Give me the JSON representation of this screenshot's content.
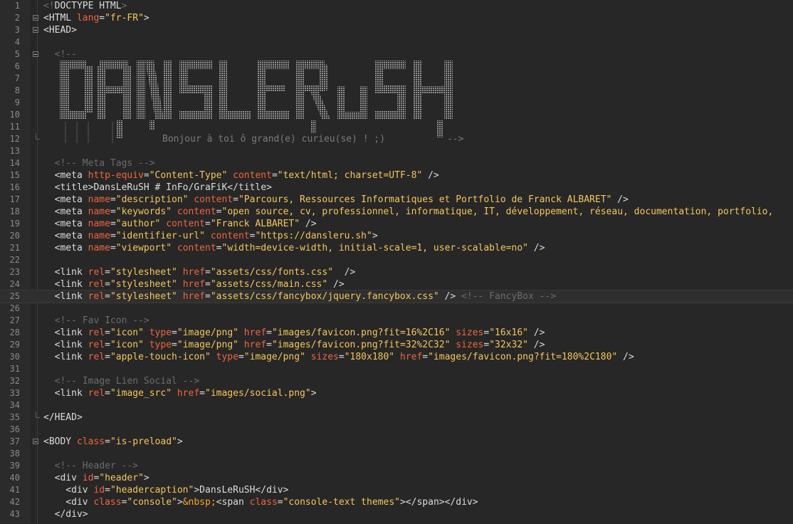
{
  "editor": {
    "lines": [
      {
        "n": "1",
        "fold": "",
        "active": false,
        "toks": [
          [
            "c",
            "<!"
          ],
          [
            "t",
            "DOCTYPE HTML"
          ],
          [
            "c",
            ">"
          ]
        ]
      },
      {
        "n": "2",
        "fold": "box",
        "active": false,
        "toks": [
          [
            "t",
            "<HTML "
          ],
          [
            "a",
            "lang"
          ],
          [
            "t",
            "="
          ],
          [
            "v",
            "\"fr-FR\""
          ],
          [
            "t",
            ">"
          ]
        ]
      },
      {
        "n": "3",
        "fold": "box",
        "active": false,
        "toks": [
          [
            "t",
            "<HEAD>"
          ]
        ]
      },
      {
        "n": "4",
        "fold": "",
        "active": false,
        "toks": []
      },
      {
        "n": "5",
        "fold": "box",
        "active": false,
        "toks": [
          [
            "t",
            "  "
          ],
          [
            "c",
            "<!--"
          ]
        ]
      },
      {
        "n": "6",
        "fold": "",
        "active": false,
        "toks": []
      },
      {
        "n": "7",
        "fold": "",
        "active": false,
        "toks": []
      },
      {
        "n": "8",
        "fold": "",
        "active": false,
        "toks": []
      },
      {
        "n": "9",
        "fold": "",
        "active": false,
        "toks": []
      },
      {
        "n": "10",
        "fold": "",
        "active": false,
        "toks": []
      },
      {
        "n": "11",
        "fold": "",
        "active": false,
        "toks": []
      },
      {
        "n": "12",
        "fold": "end",
        "active": false,
        "toks": []
      },
      {
        "n": "13",
        "fold": "",
        "active": false,
        "toks": []
      },
      {
        "n": "14",
        "fold": "",
        "active": false,
        "toks": [
          [
            "t",
            "  "
          ],
          [
            "c",
            "<!-- Meta Tags -->"
          ]
        ]
      },
      {
        "n": "15",
        "fold": "",
        "active": false,
        "toks": [
          [
            "t",
            "  <meta "
          ],
          [
            "a",
            "http-equiv"
          ],
          [
            "t",
            "="
          ],
          [
            "v",
            "\"Content-Type\""
          ],
          [
            "t",
            " "
          ],
          [
            "a",
            "content"
          ],
          [
            "t",
            "="
          ],
          [
            "v",
            "\"text/html; charset=UTF-8\""
          ],
          [
            "t",
            " />"
          ]
        ]
      },
      {
        "n": "16",
        "fold": "",
        "active": false,
        "toks": [
          [
            "t",
            "  <title>DansLeRuSH # InFo/GraFiK</title>"
          ]
        ]
      },
      {
        "n": "17",
        "fold": "",
        "active": false,
        "toks": [
          [
            "t",
            "  <meta "
          ],
          [
            "a",
            "name"
          ],
          [
            "t",
            "="
          ],
          [
            "v",
            "\"description\""
          ],
          [
            "t",
            " "
          ],
          [
            "a",
            "content"
          ],
          [
            "t",
            "="
          ],
          [
            "v",
            "\"Parcours, Ressources Informatiques et Portfolio de Franck ALBARET\""
          ],
          [
            "t",
            " />"
          ]
        ]
      },
      {
        "n": "18",
        "fold": "",
        "active": false,
        "toks": [
          [
            "t",
            "  <meta "
          ],
          [
            "a",
            "name"
          ],
          [
            "t",
            "="
          ],
          [
            "v",
            "\"keywords\""
          ],
          [
            "t",
            " "
          ],
          [
            "a",
            "content"
          ],
          [
            "t",
            "="
          ],
          [
            "v",
            "\"open source, cv, professionnel, informatique, IT, développement, réseau, documentation, portfolio,"
          ]
        ]
      },
      {
        "n": "19",
        "fold": "",
        "active": false,
        "toks": [
          [
            "t",
            "  <meta "
          ],
          [
            "a",
            "name"
          ],
          [
            "t",
            "="
          ],
          [
            "v",
            "\"author\""
          ],
          [
            "t",
            " "
          ],
          [
            "a",
            "content"
          ],
          [
            "t",
            "="
          ],
          [
            "v",
            "\"Franck ALBARET\""
          ],
          [
            "t",
            " />"
          ]
        ]
      },
      {
        "n": "20",
        "fold": "",
        "active": false,
        "toks": [
          [
            "t",
            "  <meta "
          ],
          [
            "a",
            "name"
          ],
          [
            "t",
            "="
          ],
          [
            "v",
            "\"identifier-url\""
          ],
          [
            "t",
            " "
          ],
          [
            "a",
            "content"
          ],
          [
            "t",
            "="
          ],
          [
            "v",
            "\"https://dansleru.sh\""
          ],
          [
            "t",
            ">"
          ]
        ]
      },
      {
        "n": "21",
        "fold": "",
        "active": false,
        "toks": [
          [
            "t",
            "  <meta "
          ],
          [
            "a",
            "name"
          ],
          [
            "t",
            "="
          ],
          [
            "v",
            "\"viewport\""
          ],
          [
            "t",
            " "
          ],
          [
            "a",
            "content"
          ],
          [
            "t",
            "="
          ],
          [
            "v",
            "\"width=device-width, initial-scale=1, user-scalable=no\""
          ],
          [
            "t",
            " />"
          ]
        ]
      },
      {
        "n": "22",
        "fold": "",
        "active": false,
        "toks": []
      },
      {
        "n": "23",
        "fold": "",
        "active": false,
        "toks": [
          [
            "t",
            "  <link "
          ],
          [
            "a",
            "rel"
          ],
          [
            "t",
            "="
          ],
          [
            "v",
            "\"stylesheet\""
          ],
          [
            "t",
            " "
          ],
          [
            "a",
            "href"
          ],
          [
            "t",
            "="
          ],
          [
            "v",
            "\"assets/css/fonts.css\""
          ],
          [
            "t",
            "  />"
          ]
        ]
      },
      {
        "n": "24",
        "fold": "",
        "active": false,
        "toks": [
          [
            "t",
            "  <link "
          ],
          [
            "a",
            "rel"
          ],
          [
            "t",
            "="
          ],
          [
            "v",
            "\"stylesheet\""
          ],
          [
            "t",
            " "
          ],
          [
            "a",
            "href"
          ],
          [
            "t",
            "="
          ],
          [
            "v",
            "\"assets/css/main.css\""
          ],
          [
            "t",
            " />"
          ]
        ]
      },
      {
        "n": "25",
        "fold": "",
        "active": true,
        "toks": [
          [
            "t",
            "  <link "
          ],
          [
            "a",
            "rel"
          ],
          [
            "t",
            "="
          ],
          [
            "v",
            "\"stylesheet\""
          ],
          [
            "t",
            " "
          ],
          [
            "a",
            "href"
          ],
          [
            "t",
            "="
          ],
          [
            "v",
            "\"assets/css/fancybox/jquery.fancybox.css\""
          ],
          [
            "t",
            " /> "
          ],
          [
            "c",
            "<!-- FancyBox -->"
          ]
        ]
      },
      {
        "n": "26",
        "fold": "",
        "active": false,
        "toks": []
      },
      {
        "n": "27",
        "fold": "",
        "active": false,
        "toks": [
          [
            "t",
            "  "
          ],
          [
            "c",
            "<!-- Fav Icon -->"
          ]
        ]
      },
      {
        "n": "28",
        "fold": "",
        "active": false,
        "toks": [
          [
            "t",
            "  <link "
          ],
          [
            "a",
            "rel"
          ],
          [
            "t",
            "="
          ],
          [
            "v",
            "\"icon\""
          ],
          [
            "t",
            " "
          ],
          [
            "a",
            "type"
          ],
          [
            "t",
            "="
          ],
          [
            "v",
            "\"image/png\""
          ],
          [
            "t",
            " "
          ],
          [
            "a",
            "href"
          ],
          [
            "t",
            "="
          ],
          [
            "v",
            "\"images/favicon.png?fit=16%2C16\""
          ],
          [
            "t",
            " "
          ],
          [
            "a",
            "sizes"
          ],
          [
            "t",
            "="
          ],
          [
            "v",
            "\"16x16\""
          ],
          [
            "t",
            " />"
          ]
        ]
      },
      {
        "n": "29",
        "fold": "",
        "active": false,
        "toks": [
          [
            "t",
            "  <link "
          ],
          [
            "a",
            "rel"
          ],
          [
            "t",
            "="
          ],
          [
            "v",
            "\"icon\""
          ],
          [
            "t",
            " "
          ],
          [
            "a",
            "type"
          ],
          [
            "t",
            "="
          ],
          [
            "v",
            "\"image/png\""
          ],
          [
            "t",
            " "
          ],
          [
            "a",
            "href"
          ],
          [
            "t",
            "="
          ],
          [
            "v",
            "\"images/favicon.png?fit=32%2C32\""
          ],
          [
            "t",
            " "
          ],
          [
            "a",
            "sizes"
          ],
          [
            "t",
            "="
          ],
          [
            "v",
            "\"32x32\""
          ],
          [
            "t",
            " />"
          ]
        ]
      },
      {
        "n": "30",
        "fold": "",
        "active": false,
        "toks": [
          [
            "t",
            "  <link "
          ],
          [
            "a",
            "rel"
          ],
          [
            "t",
            "="
          ],
          [
            "v",
            "\"apple-touch-icon\""
          ],
          [
            "t",
            " "
          ],
          [
            "a",
            "type"
          ],
          [
            "t",
            "="
          ],
          [
            "v",
            "\"image/png\""
          ],
          [
            "t",
            " "
          ],
          [
            "a",
            "sizes"
          ],
          [
            "t",
            "="
          ],
          [
            "v",
            "\"180x180\""
          ],
          [
            "t",
            " "
          ],
          [
            "a",
            "href"
          ],
          [
            "t",
            "="
          ],
          [
            "v",
            "\"images/favicon.png?fit=180%2C180\""
          ],
          [
            "t",
            " />"
          ]
        ]
      },
      {
        "n": "31",
        "fold": "",
        "active": false,
        "toks": []
      },
      {
        "n": "32",
        "fold": "",
        "active": false,
        "toks": [
          [
            "t",
            "  "
          ],
          [
            "c",
            "<!-- Image Lien Social -->"
          ]
        ]
      },
      {
        "n": "33",
        "fold": "",
        "active": false,
        "toks": [
          [
            "t",
            "  <link "
          ],
          [
            "a",
            "rel"
          ],
          [
            "t",
            "="
          ],
          [
            "v",
            "\"image_src\""
          ],
          [
            "t",
            " "
          ],
          [
            "a",
            "href"
          ],
          [
            "t",
            "="
          ],
          [
            "v",
            "\"images/social.png\""
          ],
          [
            "t",
            ">"
          ]
        ]
      },
      {
        "n": "34",
        "fold": "",
        "active": false,
        "toks": []
      },
      {
        "n": "35",
        "fold": "end",
        "active": false,
        "toks": [
          [
            "t",
            "</HEAD>"
          ]
        ]
      },
      {
        "n": "36",
        "fold": "",
        "active": false,
        "toks": []
      },
      {
        "n": "37",
        "fold": "box",
        "active": false,
        "toks": [
          [
            "t",
            "<BODY "
          ],
          [
            "a",
            "class"
          ],
          [
            "t",
            "="
          ],
          [
            "v",
            "\"is-preload\""
          ],
          [
            "t",
            ">"
          ]
        ]
      },
      {
        "n": "38",
        "fold": "",
        "active": false,
        "toks": []
      },
      {
        "n": "39",
        "fold": "",
        "active": false,
        "toks": [
          [
            "t",
            "  "
          ],
          [
            "c",
            "<!-- Header -->"
          ]
        ]
      },
      {
        "n": "40",
        "fold": "",
        "active": false,
        "toks": [
          [
            "t",
            "  <div "
          ],
          [
            "a",
            "id"
          ],
          [
            "t",
            "="
          ],
          [
            "v",
            "\"header\""
          ],
          [
            "t",
            ">"
          ]
        ]
      },
      {
        "n": "41",
        "fold": "",
        "active": false,
        "toks": [
          [
            "t",
            "    <div "
          ],
          [
            "a",
            "id"
          ],
          [
            "t",
            "="
          ],
          [
            "v",
            "\"headercaption\""
          ],
          [
            "t",
            ">DansLeRuSH</div>"
          ]
        ]
      },
      {
        "n": "42",
        "fold": "",
        "active": false,
        "toks": [
          [
            "t",
            "    <div "
          ],
          [
            "a",
            "class"
          ],
          [
            "t",
            "="
          ],
          [
            "v",
            "\"console\""
          ],
          [
            "t",
            ">"
          ],
          [
            "e",
            "&nbsp;"
          ],
          [
            "t",
            "<span "
          ],
          [
            "a",
            "class"
          ],
          [
            "t",
            "="
          ],
          [
            "v",
            "\"console-text themes\""
          ],
          [
            "t",
            "></span></div>"
          ]
        ]
      },
      {
        "n": "43",
        "fold": "",
        "active": false,
        "toks": [
          [
            "t",
            "  </div>"
          ]
        ]
      }
    ],
    "ascii_banner": {
      "logo_text": "DANSLERuSH",
      "message": "Bonjour à toi ô grand(e) curieu(se) ! ;)",
      "comment_close": "-->"
    },
    "colors": {
      "background": "#272727",
      "tag": "#dcdcdc",
      "attribute": "#f0643c",
      "value": "#f5c65a",
      "comment": "#6b6b6b",
      "entity": "#f5a623"
    }
  }
}
